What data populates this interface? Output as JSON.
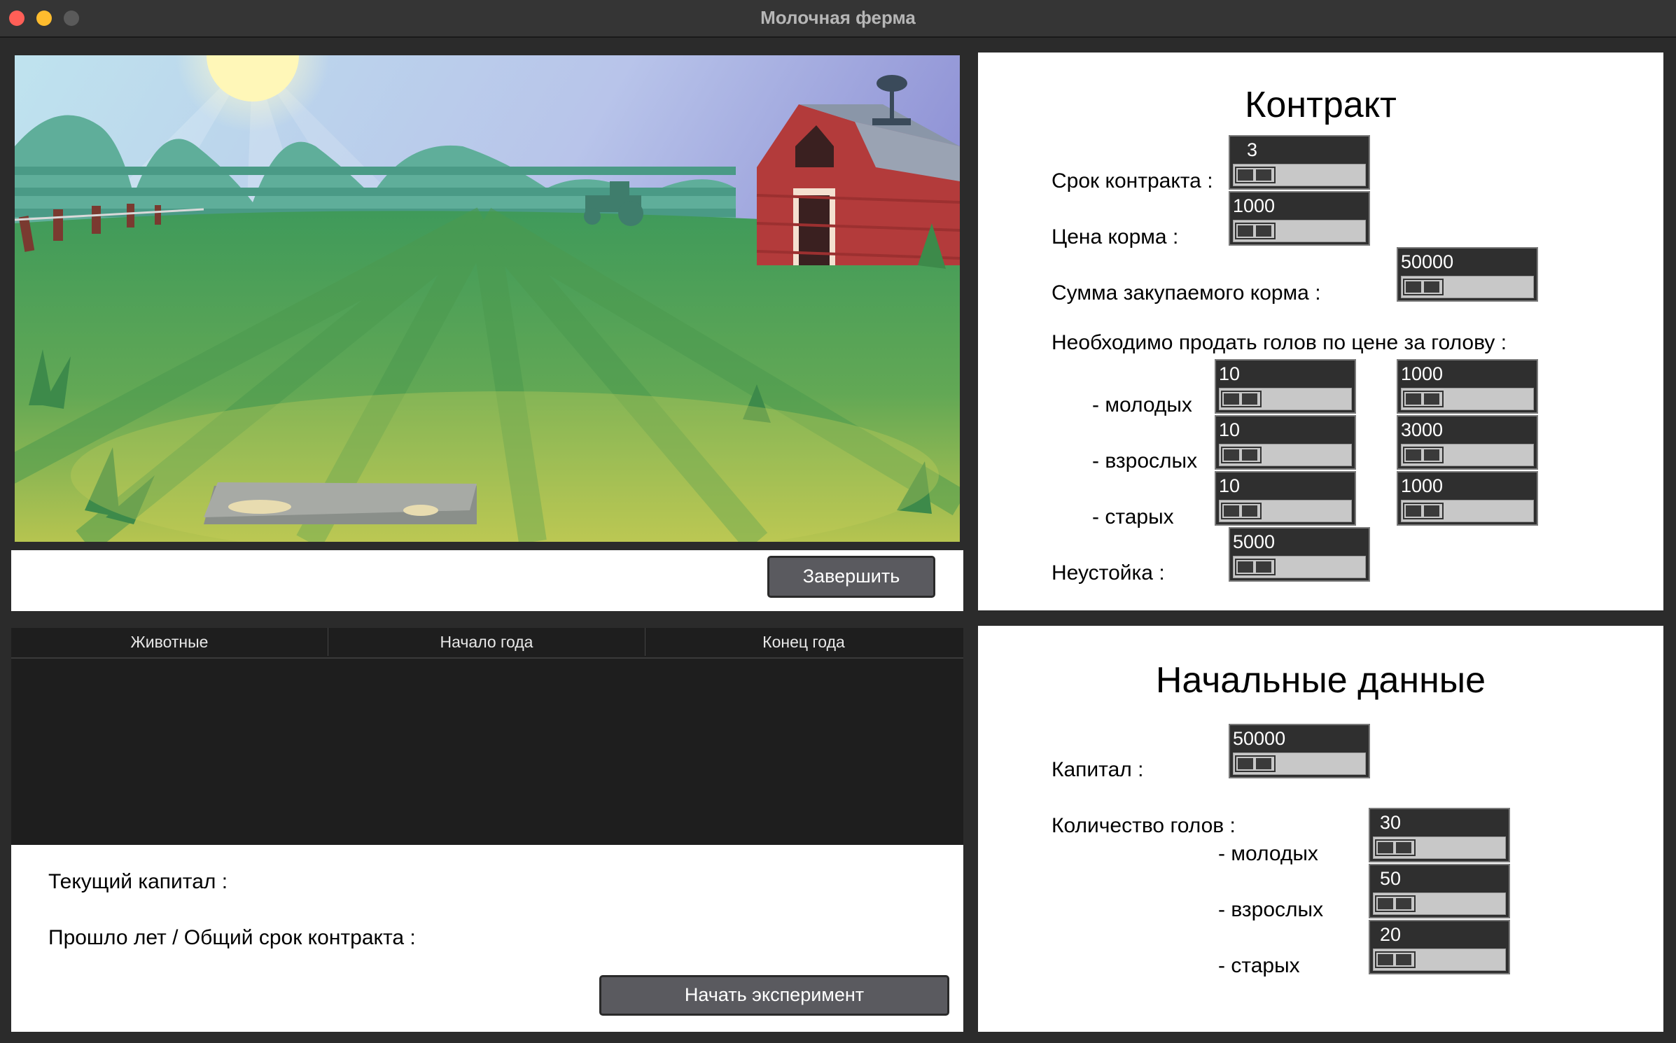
{
  "window": {
    "title": "Молочная ферма"
  },
  "controls": {
    "finish_label": "Завершить",
    "start_label": "Начать эксперимент"
  },
  "contract": {
    "title": "Контракт",
    "term_label": "Срок контракта :",
    "term_value": "3",
    "feed_price_label": "Цена корма :",
    "feed_price_value": "1000",
    "feed_sum_label": "Сумма закупаемого корма :",
    "feed_sum_value": "50000",
    "sell_label": "Необходимо продать голов по цене за голову :",
    "rows": [
      {
        "label": "- молодых",
        "count": "10",
        "price": "1000"
      },
      {
        "label": "- взрослых",
        "count": "10",
        "price": "3000"
      },
      {
        "label": "- старых",
        "count": "10",
        "price": "1000"
      }
    ],
    "penalty_label": "Неустойка :",
    "penalty_value": "5000"
  },
  "table": {
    "headers": [
      "Животные",
      "Начало года",
      "Конец года"
    ]
  },
  "status": {
    "capital_label": "Текущий капитал :",
    "years_label": "Прошло лет / Общий срок контракта :"
  },
  "initial": {
    "title": "Начальные данные",
    "capital_label": "Капитал :",
    "capital_value": "50000",
    "herd_label": "Количество голов  :",
    "rows": [
      {
        "label": "- молодых",
        "value": "30"
      },
      {
        "label": "- взрослых",
        "value": "50"
      },
      {
        "label": "- старых",
        "value": "20"
      }
    ]
  },
  "colors": {
    "titlebar": "#353535",
    "window_bg": "#2b2b2b",
    "close": "#ff5f57",
    "minimize": "#febc2e",
    "zoom": "#5a5a5a"
  },
  "icons": [
    "sun",
    "hills",
    "barn",
    "weathervane",
    "tractor",
    "fence",
    "feed-trough",
    "grass"
  ]
}
